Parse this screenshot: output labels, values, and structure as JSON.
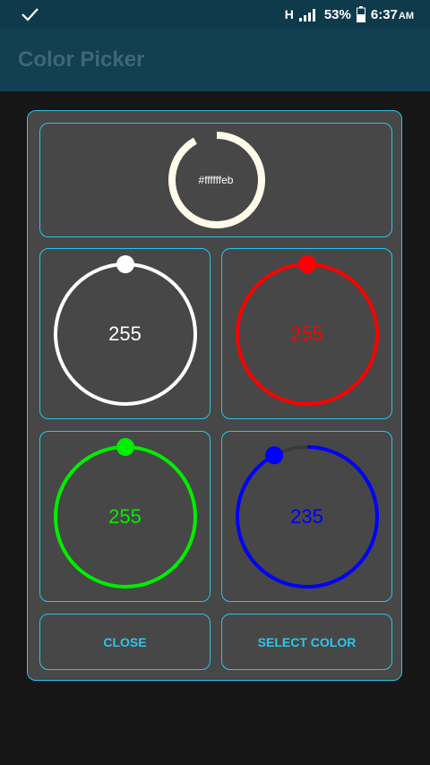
{
  "status_bar": {
    "network": "H",
    "battery": "53%",
    "time": "6:37",
    "ampm": "AM"
  },
  "app": {
    "title": "Color Picker"
  },
  "preview": {
    "hex": "#ffffffeb",
    "ring_color": "#fffbeb",
    "ring_progress": 0.92
  },
  "knobs": [
    {
      "name": "white",
      "value": "255",
      "fraction": 1.0,
      "color": "#ffffff"
    },
    {
      "name": "red",
      "value": "255",
      "fraction": 1.0,
      "color": "#ff0000"
    },
    {
      "name": "green",
      "value": "255",
      "fraction": 1.0,
      "color": "#00ee00"
    },
    {
      "name": "blue",
      "value": "235",
      "fraction": 0.9216,
      "color": "#0000ff"
    }
  ],
  "buttons": {
    "close": "CLOSE",
    "select": "SELECT COLOR"
  }
}
